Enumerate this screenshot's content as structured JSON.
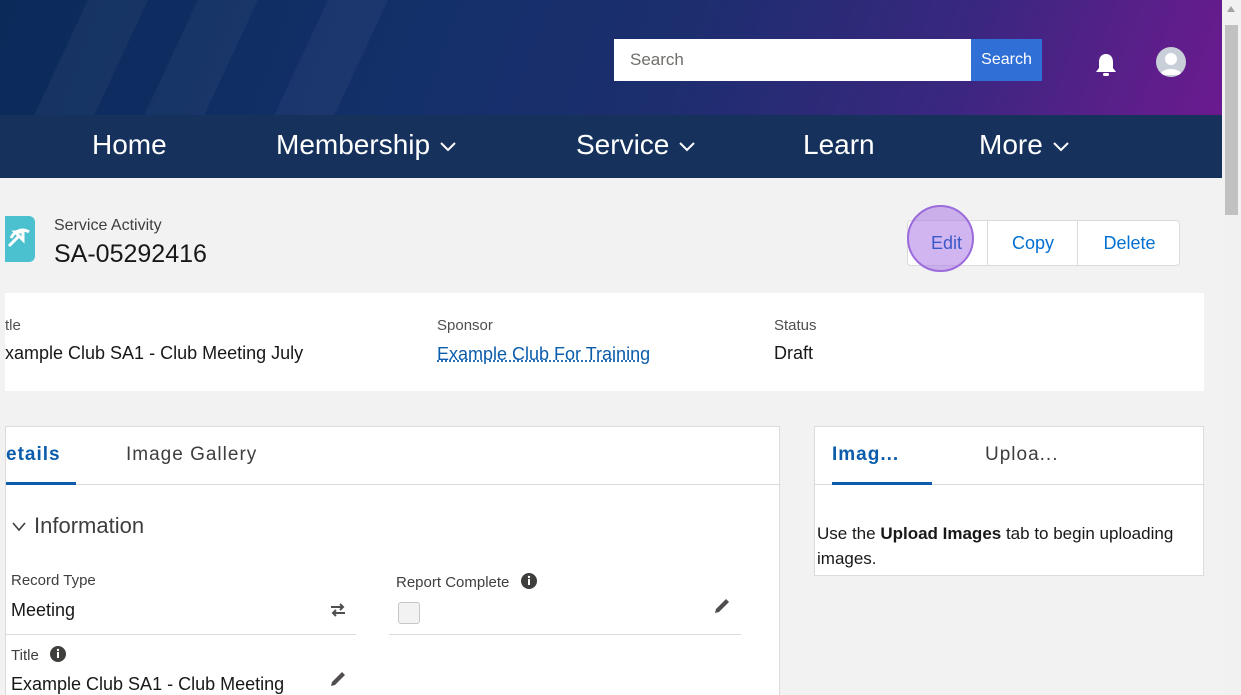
{
  "header": {
    "search_placeholder": "Search",
    "search_button": "Search"
  },
  "nav": {
    "items": [
      "Home",
      "Membership",
      "Service",
      "Learn",
      "More"
    ]
  },
  "record": {
    "object_type": "Service Activity",
    "name": "SA-05292416",
    "actions": [
      "Edit",
      "Copy",
      "Delete"
    ]
  },
  "highlights": {
    "title_label": "tle",
    "title_value": "xample Club SA1 - Club Meeting July",
    "sponsor_label": "Sponsor",
    "sponsor_value": "Example Club For Training",
    "status_label": "Status",
    "status_value": "Draft"
  },
  "details": {
    "tabs": [
      "etails",
      "Image Gallery"
    ],
    "section_title": "Information",
    "record_type_label": "Record Type",
    "record_type_value": "Meeting",
    "report_complete_label": "Report Complete",
    "title_label": "Title",
    "title_value": "Example Club SA1 - Club Meeting"
  },
  "side_panel": {
    "tabs": [
      "Imag...",
      "Uploa..."
    ],
    "help_prefix": "Use the ",
    "help_bold": "Upload Images",
    "help_suffix": " tab to begin uploading images."
  },
  "colors": {
    "brand_blue": "#0070d2",
    "nav_bg": "#16325c",
    "highlight_circle": "#aa78e6"
  }
}
